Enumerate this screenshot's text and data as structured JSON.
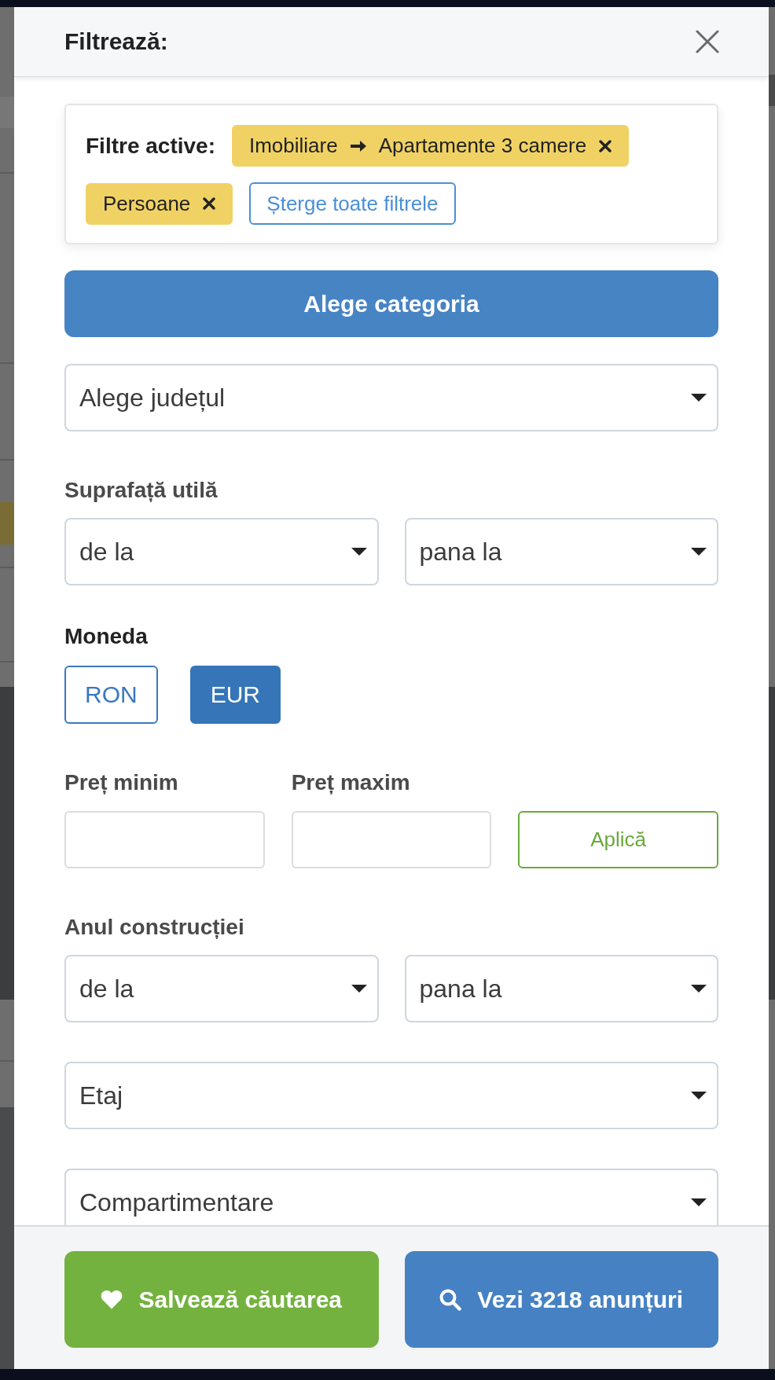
{
  "header": {
    "title": "Filtrează:"
  },
  "active_filters": {
    "label": "Filtre active:",
    "chips": [
      {
        "path": [
          "Imobiliare",
          "Apartamente 3 camere"
        ]
      },
      {
        "path": [
          "Persoane"
        ]
      }
    ],
    "clear_button": "Șterge toate filtrele"
  },
  "category_button": "Alege categoria",
  "filters": [
    {
      "kind": "select",
      "value": "Alege județul"
    },
    {
      "kind": "range",
      "label": "Suprafață utilă",
      "from": "de la",
      "to": "pana la"
    },
    {
      "kind": "currency",
      "label": "Moneda",
      "options": [
        {
          "label": "RON",
          "selected": false
        },
        {
          "label": "EUR",
          "selected": true
        }
      ]
    },
    {
      "kind": "price",
      "min_label": "Preț minim",
      "max_label": "Preț maxim",
      "apply_button": "Aplică"
    },
    {
      "kind": "range",
      "label": "Anul construcției",
      "from": "de la",
      "to": "pana la"
    },
    {
      "kind": "select",
      "value": "Etaj"
    },
    {
      "kind": "select",
      "value": "Compartimentare"
    }
  ],
  "footer": {
    "buttons": [
      {
        "kind": "save",
        "label": "Salvează căutarea"
      },
      {
        "kind": "results",
        "label": "Vezi 3218 anunțuri"
      }
    ]
  }
}
